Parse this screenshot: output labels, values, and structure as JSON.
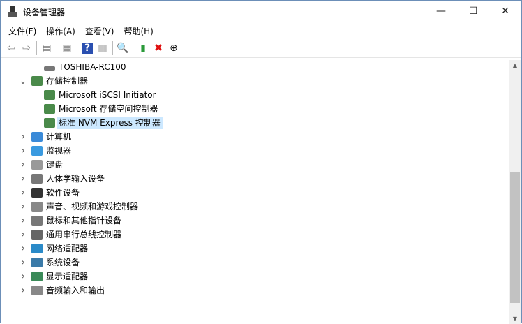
{
  "window": {
    "title": "设备管理器",
    "minimize": "—",
    "maximize": "☐",
    "close": "✕"
  },
  "menu": [
    "文件(F)",
    "操作(A)",
    "查看(V)",
    "帮助(H)"
  ],
  "toolbar": [
    {
      "name": "back",
      "glyph": "⇦",
      "color": "#888"
    },
    {
      "name": "forward",
      "glyph": "⇨",
      "color": "#888"
    },
    {
      "sep": true
    },
    {
      "name": "show-hide-console-tree",
      "glyph": "▤",
      "color": "#777"
    },
    {
      "sep": true
    },
    {
      "name": "properties",
      "glyph": "▦",
      "color": "#888"
    },
    {
      "sep": true
    },
    {
      "name": "help",
      "glyph": "?",
      "color": "#fff",
      "bg": "#2a4fb0"
    },
    {
      "name": "show-action-pane",
      "glyph": "▥",
      "color": "#777"
    },
    {
      "sep": true
    },
    {
      "name": "scan-hardware",
      "glyph": "🔍",
      "color": "#2a86c8"
    },
    {
      "sep": true
    },
    {
      "name": "update-driver",
      "glyph": "▮",
      "color": "#2a9a3a"
    },
    {
      "name": "uninstall-device",
      "glyph": "✖",
      "color": "#e01010"
    },
    {
      "name": "disable-device",
      "glyph": "⊕",
      "color": "#111"
    }
  ],
  "tree": [
    {
      "level": 2,
      "label": "TOSHIBA-RC100",
      "icon": "disk",
      "expand": ""
    },
    {
      "level": 1,
      "label": "存储控制器",
      "icon": "storage",
      "expand": "open"
    },
    {
      "level": 2,
      "label": "Microsoft iSCSI Initiator",
      "icon": "storage",
      "expand": ""
    },
    {
      "level": 2,
      "label": "Microsoft 存储空间控制器",
      "icon": "storage",
      "expand": ""
    },
    {
      "level": 2,
      "label": "标准 NVM Express 控制器",
      "icon": "storage",
      "expand": "",
      "selected": true
    },
    {
      "level": 1,
      "label": "计算机",
      "icon": "computer",
      "expand": "closed"
    },
    {
      "level": 1,
      "label": "监视器",
      "icon": "monitor",
      "expand": "closed"
    },
    {
      "level": 1,
      "label": "键盘",
      "icon": "keyboard",
      "expand": "closed"
    },
    {
      "level": 1,
      "label": "人体学输入设备",
      "icon": "hid",
      "expand": "closed"
    },
    {
      "level": 1,
      "label": "软件设备",
      "icon": "software",
      "expand": "closed"
    },
    {
      "level": 1,
      "label": "声音、视频和游戏控制器",
      "icon": "sound",
      "expand": "closed"
    },
    {
      "level": 1,
      "label": "鼠标和其他指针设备",
      "icon": "mouse",
      "expand": "closed"
    },
    {
      "level": 1,
      "label": "通用串行总线控制器",
      "icon": "usb",
      "expand": "closed"
    },
    {
      "level": 1,
      "label": "网络适配器",
      "icon": "network",
      "expand": "closed"
    },
    {
      "level": 1,
      "label": "系统设备",
      "icon": "system",
      "expand": "closed"
    },
    {
      "level": 1,
      "label": "显示适配器",
      "icon": "display",
      "expand": "closed"
    },
    {
      "level": 1,
      "label": "音频输入和输出",
      "icon": "audio",
      "expand": "closed"
    }
  ]
}
